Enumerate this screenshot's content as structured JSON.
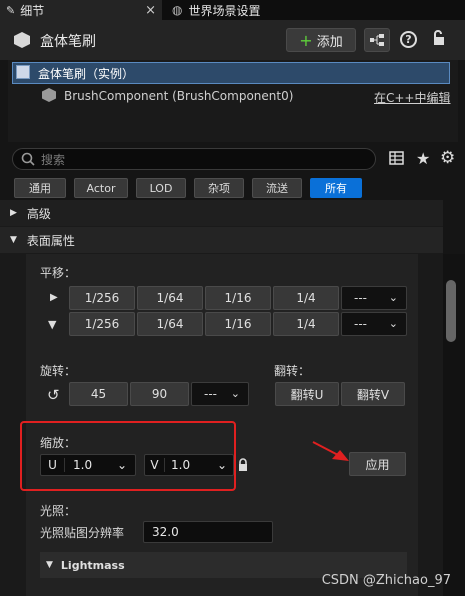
{
  "tabs": {
    "details": "细节",
    "close": "×",
    "world": "世界场景设置"
  },
  "header": {
    "title": "盒体笔刷",
    "add": "添加",
    "add_plus": "+"
  },
  "tree": {
    "root": "盒体笔刷（实例）",
    "child": "BrushComponent (BrushComponent0)",
    "edit_link": "在C++中编辑"
  },
  "search": {
    "placeholder": "搜索"
  },
  "filters": [
    "通用",
    "Actor",
    "LOD",
    "杂项",
    "流送",
    "所有"
  ],
  "categories": {
    "advanced": "高级",
    "surface": "表面属性"
  },
  "pan": {
    "label": "平移：",
    "values": [
      "1/256",
      "1/64",
      "1/16",
      "1/4"
    ],
    "dropdown": "---"
  },
  "rotate": {
    "label": "旋转：",
    "values": [
      "45",
      "90"
    ],
    "dropdown": "---"
  },
  "flip": {
    "label": "翻转：",
    "u": "翻转U",
    "v": "翻转V"
  },
  "scale": {
    "label": "缩放：",
    "u_label": "U",
    "u_value": "1.0",
    "v_label": "V",
    "v_value": "1.0",
    "apply": "应用"
  },
  "lighting": {
    "label": "光照：",
    "lightmap_label": "光照贴图分辨率",
    "lightmap_value": "32.0",
    "lightmass": "Lightmass"
  },
  "watermark": "CSDN @Zhichao_97",
  "colors": {
    "accent": "#0a70d8",
    "highlight_box": "#e02020",
    "arrow": "#e02020"
  }
}
